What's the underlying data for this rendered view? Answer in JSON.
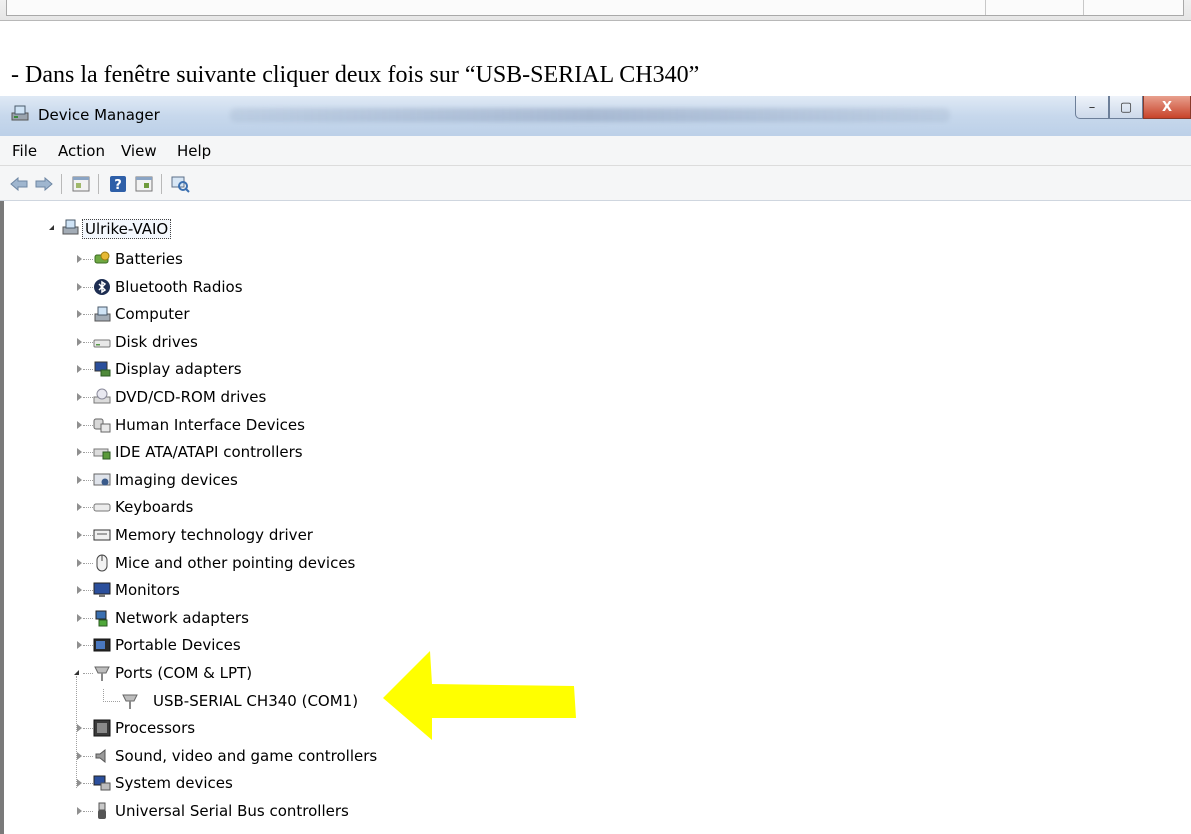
{
  "instruction": "- Dans la fenêtre suivante cliquer deux fois sur “USB-SERIAL CH340”",
  "window": {
    "title": "Device Manager",
    "controls": {
      "minimize": "–",
      "maximize": "▢",
      "close": "X"
    }
  },
  "menu": [
    "File",
    "Action",
    "View",
    "Help"
  ],
  "toolbar": {
    "back": "back-icon",
    "forward": "forward-icon",
    "properties": "properties-icon",
    "help": "help-icon",
    "update": "update-driver-icon",
    "scan": "scan-hardware-icon"
  },
  "tree": {
    "root": "Ulrike-VAIO",
    "categories": [
      {
        "label": "Batteries",
        "icon": "battery-icon"
      },
      {
        "label": "Bluetooth Radios",
        "icon": "bluetooth-icon"
      },
      {
        "label": "Computer",
        "icon": "computer-icon"
      },
      {
        "label": "Disk drives",
        "icon": "disk-drive-icon"
      },
      {
        "label": "Display adapters",
        "icon": "display-adapter-icon"
      },
      {
        "label": "DVD/CD-ROM drives",
        "icon": "dvd-drive-icon"
      },
      {
        "label": "Human Interface Devices",
        "icon": "hid-icon"
      },
      {
        "label": "IDE ATA/ATAPI controllers",
        "icon": "ide-controller-icon"
      },
      {
        "label": "Imaging devices",
        "icon": "imaging-device-icon"
      },
      {
        "label": "Keyboards",
        "icon": "keyboard-icon"
      },
      {
        "label": "Memory technology driver",
        "icon": "memory-icon"
      },
      {
        "label": "Mice and other pointing devices",
        "icon": "mouse-icon"
      },
      {
        "label": "Monitors",
        "icon": "monitor-icon"
      },
      {
        "label": "Network adapters",
        "icon": "network-adapter-icon"
      },
      {
        "label": "Portable Devices",
        "icon": "portable-device-icon"
      },
      {
        "label": "Ports (COM & LPT)",
        "icon": "port-icon",
        "expanded": true
      },
      {
        "label": "USB-SERIAL CH340 (COM1)",
        "icon": "port-icon",
        "child": true
      },
      {
        "label": "Processors",
        "icon": "processor-icon"
      },
      {
        "label": "Sound, video and game controllers",
        "icon": "sound-icon"
      },
      {
        "label": "System devices",
        "icon": "system-device-icon"
      },
      {
        "label": "Universal Serial Bus controllers",
        "icon": "usb-icon"
      }
    ]
  },
  "colors": {
    "highlight_arrow": "#ffff00"
  }
}
